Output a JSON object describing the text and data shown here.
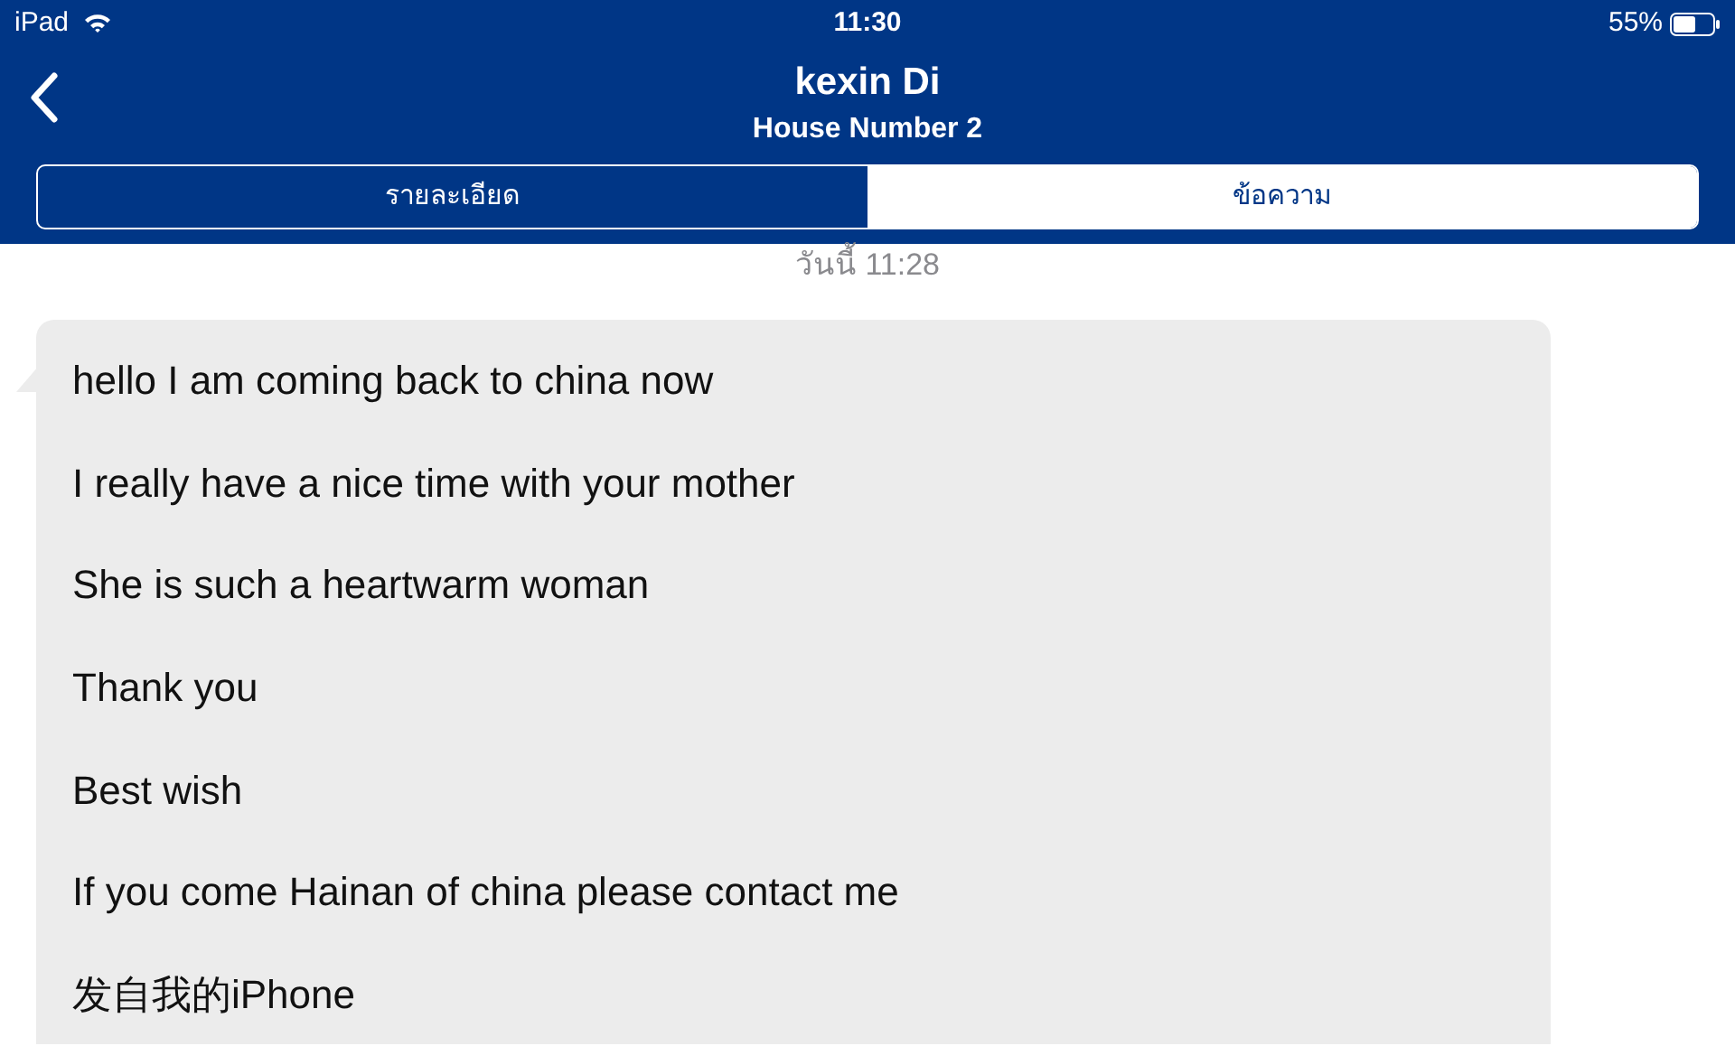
{
  "status_bar": {
    "device": "iPad",
    "time": "11:30",
    "battery": "55%"
  },
  "nav": {
    "title": "kexin Di",
    "subtitle": "House Number 2"
  },
  "tabs": [
    {
      "label": "รายละเอียด",
      "selected": false
    },
    {
      "label": "ข้อความ",
      "selected": true
    }
  ],
  "timestamp": "วันนี้ 11:28",
  "message": {
    "lines": [
      "hello I am coming back to china now",
      "I really have a nice time with your mother",
      "She is such a heartwarm woman",
      "Thank you",
      "Best wish",
      "If you come Hainan of china please contact me",
      "发自我的iPhone"
    ]
  }
}
